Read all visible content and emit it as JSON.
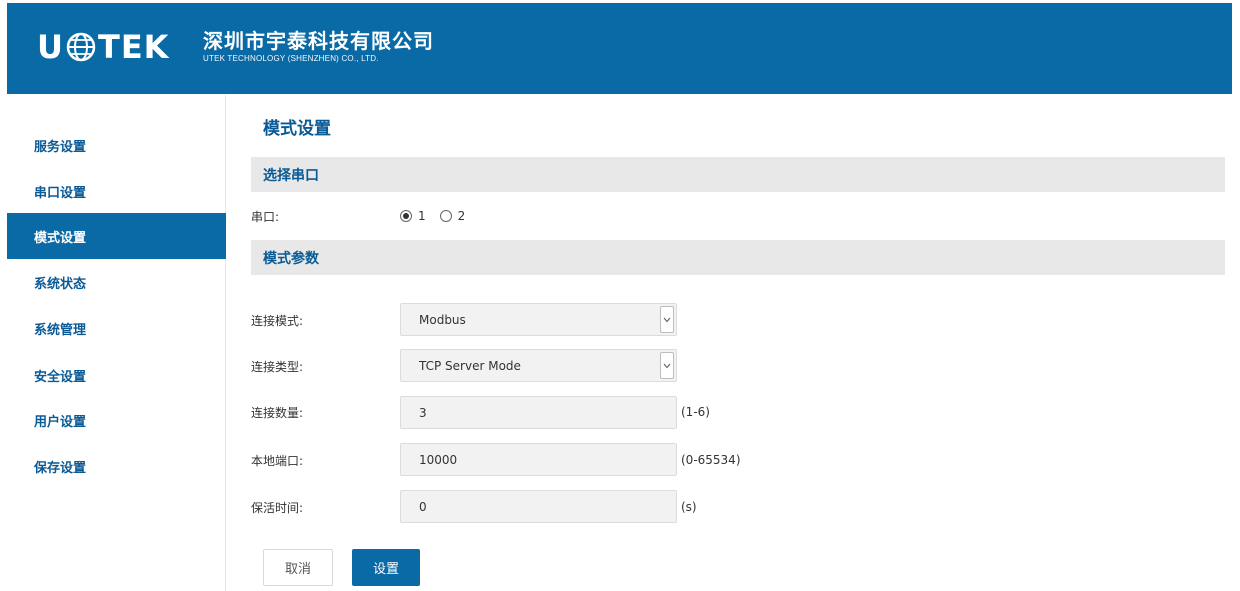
{
  "header": {
    "logo_text_left": "U",
    "logo_text_right": "TEK",
    "company_cn": "深圳市宇泰科技有限公司",
    "company_en": "UTEK TECHNOLOGY (SHENZHEN) CO., LTD.",
    "brand_color": "#0a6aa6"
  },
  "sidebar": {
    "items": [
      {
        "label": "服务设置",
        "active": false
      },
      {
        "label": "串口设置",
        "active": false
      },
      {
        "label": "模式设置",
        "active": true
      },
      {
        "label": "系统状态",
        "active": false
      },
      {
        "label": "系统管理",
        "active": false
      },
      {
        "label": "安全设置",
        "active": false
      },
      {
        "label": "用户设置",
        "active": false
      },
      {
        "label": "保存设置",
        "active": false
      }
    ]
  },
  "main": {
    "title": "模式设置",
    "section_serial": "选择串口",
    "serial_label": "串口:",
    "serial_options": [
      {
        "label": "1",
        "checked": true
      },
      {
        "label": "2",
        "checked": false
      }
    ],
    "section_params": "模式参数",
    "fields": {
      "mode": {
        "label": "连接模式:",
        "value": "Modbus"
      },
      "type": {
        "label": "连接类型:",
        "value": "TCP Server Mode"
      },
      "count": {
        "label": "连接数量:",
        "value": "3",
        "hint": "(1-6)"
      },
      "port": {
        "label": "本地端口:",
        "value": "10000",
        "hint": "(0-65534)"
      },
      "keepalive": {
        "label": "保活时间:",
        "value": "0",
        "hint": "(s)"
      }
    },
    "buttons": {
      "cancel": "取消",
      "set": "设置"
    }
  }
}
